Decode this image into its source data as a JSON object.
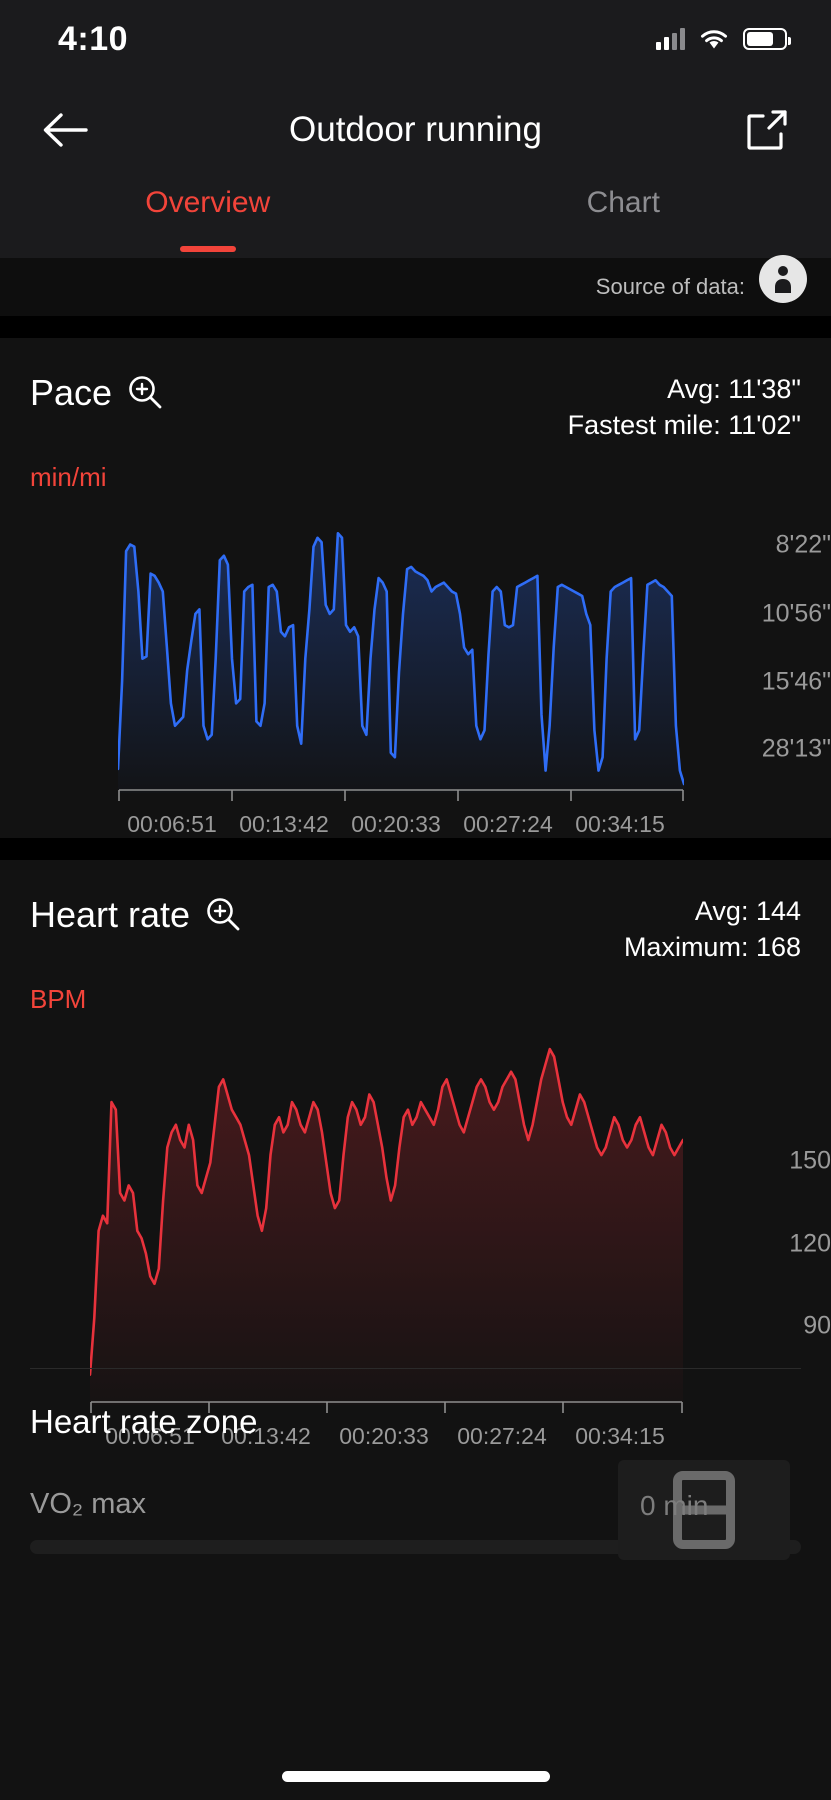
{
  "status_bar": {
    "time": "4:10",
    "icons": {
      "cellular": "cellular-bars-icon",
      "wifi": "wifi-icon",
      "battery": "battery-icon"
    },
    "battery_level_pct": 72
  },
  "nav": {
    "back_icon": "back-arrow-icon",
    "title": "Outdoor running",
    "share_icon": "share-export-icon"
  },
  "tabs": [
    {
      "label": "Overview",
      "active": true
    },
    {
      "label": "Chart",
      "active": false
    }
  ],
  "source": {
    "label": "Source of data:",
    "icon": "data-source-avatar-icon"
  },
  "colors": {
    "accent_red": "#f2443a",
    "pace_blue": "#2f6df6",
    "hr_red": "#e8323c",
    "card_bg": "#121212",
    "page_bg": "#000000",
    "chrome_bg": "#1b1b1d",
    "muted_text": "#9a9a9a"
  },
  "pace_card": {
    "title": "Pace",
    "zoom_icon": "magnifier-plus-icon",
    "avg_label": "Avg: 11'38\"",
    "fastest_label": "Fastest mile: 11'02\""
  },
  "hr_card": {
    "title": "Heart rate",
    "zoom_icon": "magnifier-plus-icon",
    "avg_label": "Avg: 144",
    "max_label": "Maximum: 168"
  },
  "bottom_rows": [
    {
      "title": "Heart rate zone"
    },
    {
      "title": "VO₂ max"
    }
  ],
  "overlay": {
    "glyph": "picture-in-picture-card-icon",
    "text": "0 min"
  },
  "chart_data": [
    {
      "type": "line",
      "id": "pace",
      "title": "Pace",
      "ylabel": "min/mi",
      "xlabel": "",
      "grid": false,
      "legend": "none",
      "line_color": "#2f6df6",
      "fill": "gradient",
      "yticks": [
        "8'22\"",
        "10'56\"",
        "15'46\"",
        "28'13\""
      ],
      "ytick_seconds": [
        502,
        656,
        946,
        1693
      ],
      "xticks": [
        "00:06:51",
        "00:13:42",
        "00:20:33",
        "00:27:24",
        "00:34:15"
      ],
      "xtick_seconds": [
        411,
        822,
        1233,
        1644,
        2055
      ],
      "annotations": [
        "Avg: 11'38\"",
        "Fastest mile: 11'02\""
      ],
      "values": [
        1693,
        1300,
        720,
        690,
        700,
        900,
        1200,
        1190,
        820,
        830,
        860,
        900,
        1150,
        1400,
        1500,
        1480,
        1460,
        1250,
        1120,
        1000,
        980,
        1500,
        1560,
        1540,
        1200,
        760,
        740,
        780,
        1200,
        1400,
        1380,
        900,
        880,
        870,
        1480,
        1500,
        1400,
        880,
        870,
        900,
        1080,
        1100,
        1060,
        1050,
        1500,
        1580,
        1200,
        980,
        700,
        660,
        680,
        960,
        1000,
        980,
        640,
        660,
        1050,
        1080,
        1060,
        1100,
        1500,
        1540,
        1200,
        980,
        840,
        860,
        900,
        1620,
        1640,
        1260,
        1000,
        800,
        790,
        810,
        820,
        830,
        850,
        900,
        880,
        870,
        860,
        880,
        900,
        910,
        1000,
        1150,
        1180,
        1160,
        1500,
        1560,
        1520,
        1180,
        900,
        880,
        900,
        1050,
        1060,
        1050,
        880,
        870,
        860,
        850,
        840,
        830,
        1450,
        1700,
        1500,
        1150,
        880,
        870,
        880,
        890,
        900,
        910,
        920,
        1000,
        1050,
        1520,
        1700,
        1640,
        1200,
        900,
        880,
        870,
        860,
        850,
        840,
        1560,
        1520,
        1180,
        870,
        860,
        850,
        870,
        880,
        900,
        920,
        1500,
        1700,
        1760
      ],
      "ylim_seconds": [
        460,
        1800
      ],
      "xlim_seconds": [
        0,
        2200
      ]
    },
    {
      "type": "line",
      "id": "heart_rate",
      "title": "Heart rate",
      "ylabel": "BPM",
      "xlabel": "",
      "grid": false,
      "legend": "none",
      "line_color": "#e8323c",
      "fill": "gradient",
      "yticks": [
        "150",
        "120",
        "90"
      ],
      "ytick_values": [
        150,
        120,
        90
      ],
      "xticks": [
        "00:06:51",
        "00:13:42",
        "00:20:33",
        "00:27:24",
        "00:34:15"
      ],
      "xtick_seconds": [
        411,
        822,
        1233,
        1644,
        2055
      ],
      "annotations": [
        "Avg: 144",
        "Maximum: 168"
      ],
      "values": [
        80,
        95,
        118,
        122,
        120,
        152,
        150,
        128,
        126,
        130,
        128,
        118,
        116,
        112,
        106,
        104,
        108,
        126,
        140,
        144,
        146,
        142,
        140,
        146,
        142,
        130,
        128,
        132,
        136,
        146,
        156,
        158,
        154,
        150,
        148,
        146,
        142,
        138,
        130,
        122,
        118,
        124,
        138,
        146,
        148,
        144,
        146,
        152,
        150,
        146,
        144,
        148,
        152,
        150,
        144,
        136,
        128,
        124,
        126,
        138,
        148,
        152,
        150,
        146,
        148,
        154,
        152,
        146,
        140,
        132,
        126,
        130,
        140,
        148,
        150,
        146,
        148,
        152,
        150,
        148,
        146,
        150,
        156,
        158,
        154,
        150,
        146,
        144,
        148,
        152,
        156,
        158,
        156,
        152,
        150,
        152,
        156,
        158,
        160,
        158,
        152,
        146,
        142,
        146,
        152,
        158,
        162,
        166,
        164,
        158,
        152,
        148,
        146,
        150,
        154,
        152,
        148,
        144,
        140,
        138,
        140,
        144,
        148,
        146,
        142,
        140,
        142,
        146,
        148,
        144,
        140,
        138,
        142,
        146,
        144,
        140,
        138,
        140,
        142
      ],
      "ylim": [
        72,
        175
      ],
      "xlim_seconds": [
        0,
        2200
      ]
    }
  ]
}
